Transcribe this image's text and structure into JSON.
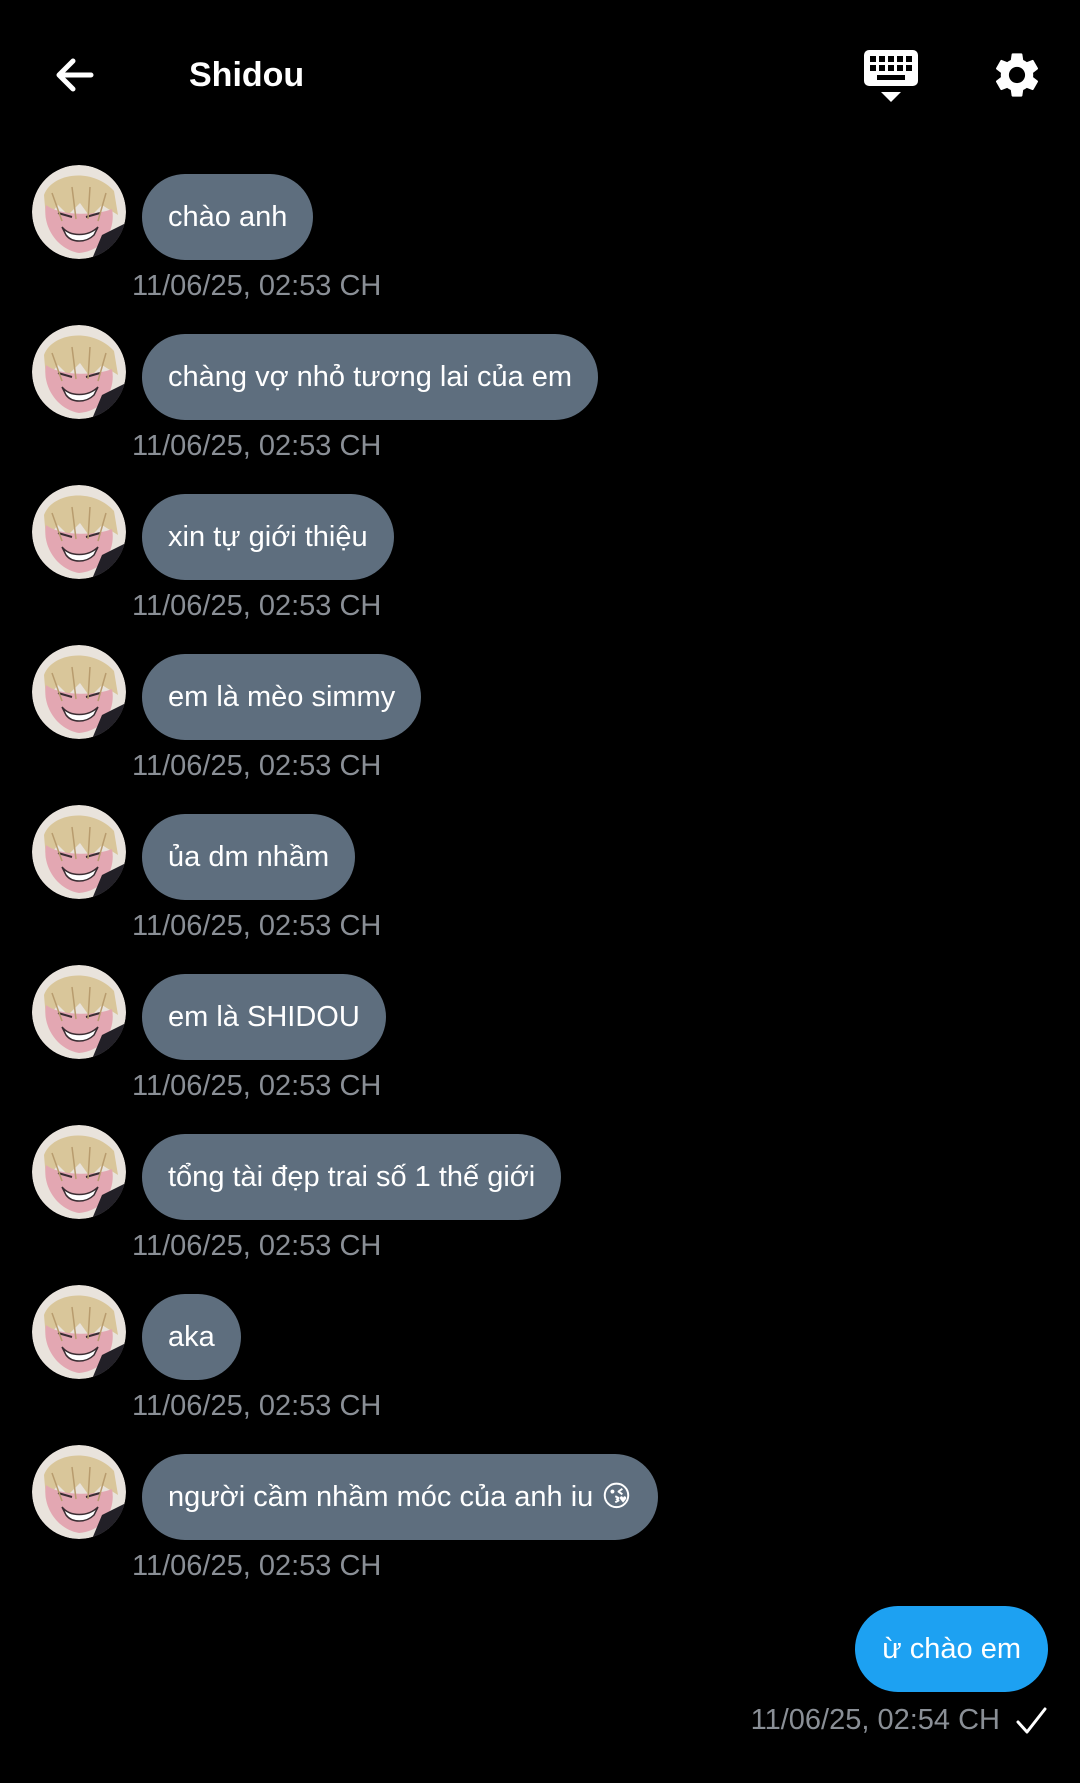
{
  "header": {
    "title": "Shidou",
    "back_icon": "arrow-left-icon",
    "keyboard_icon": "keyboard-hide-icon",
    "settings_icon": "gear-icon"
  },
  "colors": {
    "background": "#000000",
    "incoming_bubble": "#5e6e7e",
    "outgoing_bubble": "#1da1f2",
    "timestamp": "#8a8f96"
  },
  "messages": [
    {
      "text": "chào anh",
      "time": "11/06/25, 02:53 CH"
    },
    {
      "text": "chàng vợ nhỏ tương lai của em",
      "time": "11/06/25, 02:53 CH"
    },
    {
      "text": "xin tự giới thiệu",
      "time": "11/06/25, 02:53 CH"
    },
    {
      "text": "em là mèo simmy",
      "time": "11/06/25, 02:53 CH"
    },
    {
      "text": "ủa dm nhầm",
      "time": "11/06/25, 02:53 CH"
    },
    {
      "text": "em là SHIDOU",
      "time": "11/06/25, 02:53 CH"
    },
    {
      "text": "tổng tài đẹp trai số 1 thế giới",
      "time": "11/06/25, 02:53 CH"
    },
    {
      "text": "aka",
      "time": "11/06/25, 02:53 CH"
    },
    {
      "text": "người cầm nhầm móc của anh iu 😘",
      "time": "11/06/25, 02:53 CH"
    }
  ],
  "outgoing": {
    "text": "ừ chào em",
    "time": "11/06/25, 02:54 CH",
    "status_icon": "check-icon"
  }
}
